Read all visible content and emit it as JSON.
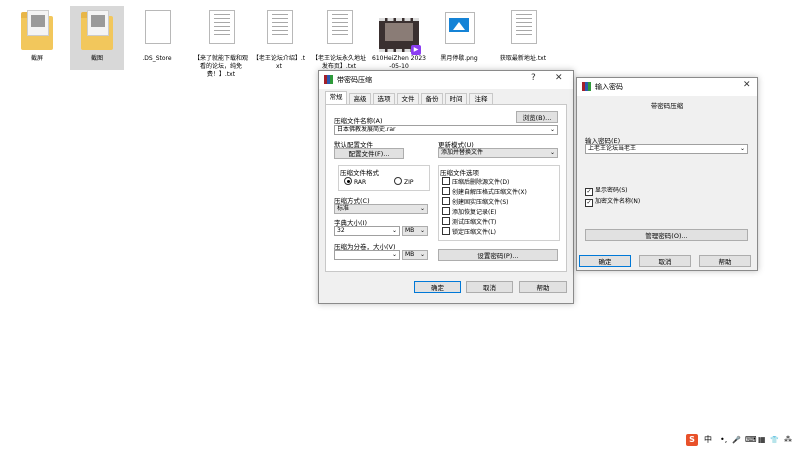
{
  "desktop": {
    "icons": [
      {
        "label": "截屏"
      },
      {
        "label": "截图"
      },
      {
        "label": ".DS_Store"
      },
      {
        "label": "【来了就能下载和观看的论坛，纯免费！】.txt"
      },
      {
        "label": "【老王论坛介绍】.txt"
      },
      {
        "label": "【老王论坛永久地址发布页】.txt"
      },
      {
        "label": "610HeiZhen 2023-05-10"
      },
      {
        "label": "黑月停歇.png"
      },
      {
        "label": "获取最新地址.txt"
      }
    ]
  },
  "archive_dialog": {
    "title": "带密码压缩",
    "help_icon": "?",
    "close_icon": "✕",
    "tabs": [
      "常规",
      "高级",
      "选项",
      "文件",
      "备份",
      "时间",
      "注释"
    ],
    "archive_name_label": "压缩文件名称(A)",
    "browse_button": "浏览(B)...",
    "archive_name_value": "日本佛教发展简史.rar",
    "default_profile_label": "默认配置文件",
    "profile_button": "配置文件(F)...",
    "update_mode_label": "更新模式(U)",
    "update_mode_value": "添加并替换文件",
    "format_group_label": "压缩文件格式",
    "format_rar": "RAR",
    "format_zip": "ZIP",
    "options_group_label": "压缩文件选项",
    "options": [
      {
        "label": "压缩后删除源文件(D)",
        "checked": false
      },
      {
        "label": "创建自解压格式压缩文件(X)",
        "checked": false
      },
      {
        "label": "创建固实压缩文件(S)",
        "checked": false
      },
      {
        "label": "添加恢复记录(E)",
        "checked": false
      },
      {
        "label": "测试压缩文件(T)",
        "checked": false
      },
      {
        "label": "锁定压缩文件(L)",
        "checked": false
      }
    ],
    "method_label": "压缩方式(C)",
    "method_value": "标准",
    "dict_label": "字典大小(I)",
    "dict_value": "32",
    "dict_unit": "MB",
    "split_label": "压缩为分卷，大小(V)",
    "split_value": "",
    "split_unit": "MB",
    "set_password_button": "设置密码(P)...",
    "ok_button": "确定",
    "cancel_button": "取消",
    "help_button": "帮助"
  },
  "password_dialog": {
    "title": "输入密码",
    "close_icon": "✕",
    "subtitle": "带密码压缩",
    "enter_label": "输入密码(E)",
    "password_value": "上老王论坛当老王",
    "show_password_label": "显示密码(S)",
    "show_password_checked": true,
    "encrypt_names_label": "加密文件名称(N)",
    "encrypt_names_checked": true,
    "manage_button": "管理密码(O)...",
    "ok_button": "确定",
    "cancel_button": "取消",
    "help_button": "帮助"
  },
  "tray": {
    "ime_logo": "S",
    "ime_mode": "中",
    "punct": "•,",
    "mic": "🎤",
    "keyboard": "⌨",
    "grid": "▦",
    "skin": "👕",
    "more": "⁂"
  }
}
